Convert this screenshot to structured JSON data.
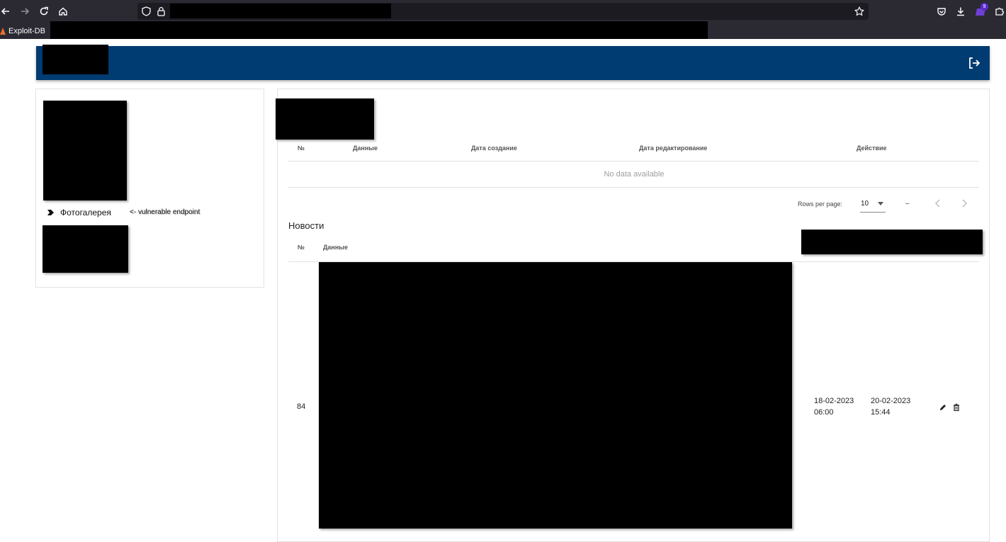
{
  "browser": {
    "bookmark_label": "Exploit-DB",
    "extension_badge": "9"
  },
  "sidebar": {
    "items": [
      {
        "label": "Фотогалерея"
      }
    ],
    "annotation": "<- vulnerable endpoint"
  },
  "main": {
    "table1": {
      "headers": [
        "№",
        "Данные",
        "Дата создание",
        "Дата редактирование",
        "Действие"
      ],
      "empty_text": "No data available"
    },
    "pagination": {
      "rows_per_page_label": "Rows per page:",
      "rows_per_page_value": "10",
      "range": "–"
    },
    "news": {
      "title": "Новости",
      "headers": [
        "№",
        "Данные"
      ],
      "rows": [
        {
          "id": "84",
          "created_date": "18-02-2023",
          "created_time": "06:00",
          "edited_date": "20-02-2023",
          "edited_time": "15:44"
        }
      ]
    }
  },
  "colors": {
    "header_bg": "#003c71",
    "browser_bg": "#2b2a33",
    "url_bg": "#1c1b22"
  },
  "icons": [
    "back-icon",
    "forward-icon",
    "reload-icon",
    "home-icon",
    "shield-icon",
    "lock-icon",
    "star-icon",
    "pocket-icon",
    "download-icon",
    "extension-icon",
    "extensions-puzzle-icon",
    "logout-icon",
    "chevron-left-icon",
    "chevron-right-icon",
    "edit-icon",
    "delete-icon"
  ]
}
